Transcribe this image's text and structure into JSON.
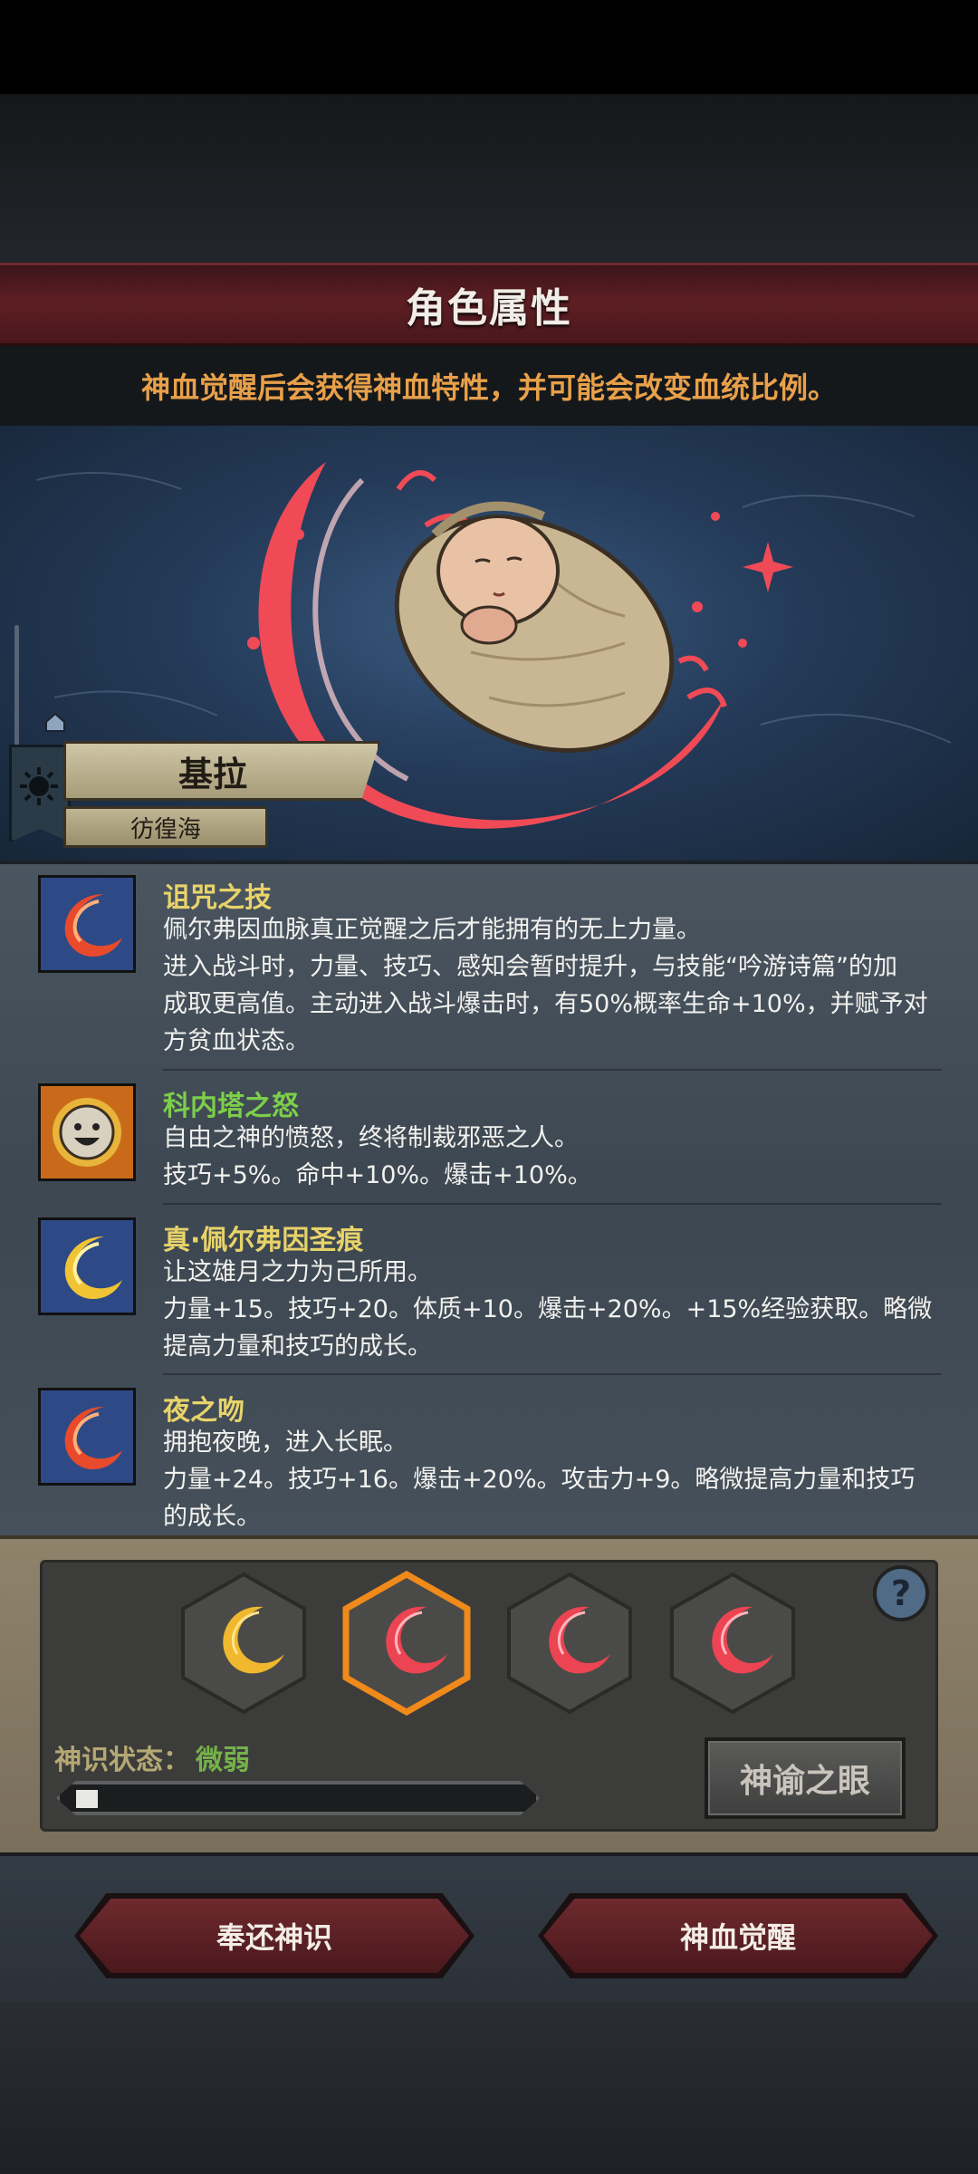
{
  "header": {
    "title": "角色属性",
    "subtitle": "神血觉醒后会获得神血特性，并可能会改变血统比例。"
  },
  "character": {
    "name": "基拉",
    "location": "彷徨海"
  },
  "skills": [
    {
      "name": "诅咒之技",
      "name_color": "#e8d36a",
      "icon": "red-crescent-flame-icon",
      "lines": [
        "佩尔弗因血脉真正觉醒之后才能拥有的无上力量。",
        "进入战斗时，力量、技巧、感知会暂时提升，与技能“吟游诗篇”的加",
        "成取更高值。主动进入战斗爆击时，有50%概率生命+10%，并赋予对",
        "方贫血状态。"
      ]
    },
    {
      "name": "科内塔之怒",
      "name_color": "#7ccf4a",
      "icon": "smiling-sun-icon",
      "lines": [
        "自由之神的愤怒，终将制裁邪恶之人。",
        "技巧+5%。命中+10%。爆击+10%。"
      ]
    },
    {
      "name": "真·佩尔弗因圣痕",
      "name_color": "#e8d36a",
      "icon": "gold-crescent-icon",
      "lines": [
        "让这雄月之力为己所用。",
        "力量+15。技巧+20。体质+10。爆击+20%。+15%经验获取。略微",
        "提高力量和技巧的成长。"
      ]
    },
    {
      "name": "夜之吻",
      "name_color": "#e8d36a",
      "icon": "red-crescent-flame-icon",
      "lines": [
        "拥抱夜晚，进入长眠。",
        "力量+24。技巧+16。爆击+20%。攻击力+9。略微提高力量和技巧",
        "的成长。"
      ]
    }
  ],
  "awakening": {
    "gems": [
      {
        "color": "gold",
        "selected": false
      },
      {
        "color": "red",
        "selected": true
      },
      {
        "color": "red",
        "selected": false
      },
      {
        "color": "red",
        "selected": false
      }
    ],
    "help_label": "?",
    "status_label": "神识状态：",
    "status_value": "微弱",
    "progress": 0.04,
    "oracle_button": "神谕之眼"
  },
  "footer": {
    "return_button": "奉还神识",
    "awaken_button": "神血觉醒"
  },
  "colors": {
    "accent_red": "#5d1e23",
    "subtitle_orange": "#e8a04a",
    "status_green": "#75b24a",
    "status_label": "#b5a874"
  }
}
